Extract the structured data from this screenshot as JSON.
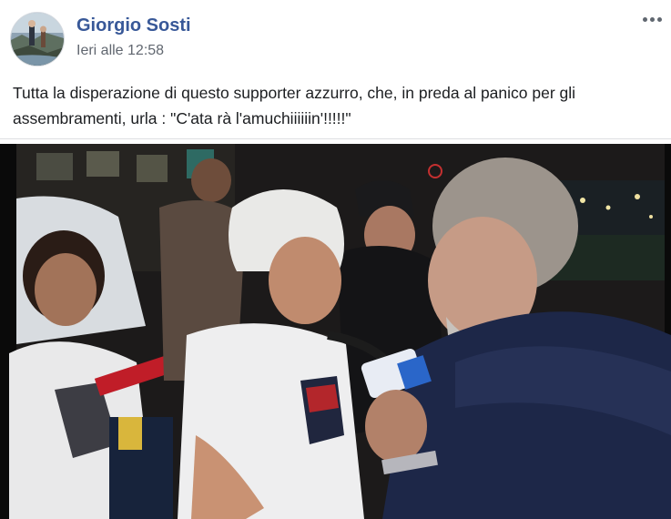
{
  "post": {
    "author": "Giorgio Sosti",
    "timestamp": "Ieri alle 12:58",
    "text": "Tutta la disperazione di questo supporter azzurro, che, in preda al panico per gli assembramenti, urla : \"C'ata rà l'amuchiiiiiin'!!!!!\""
  },
  "icons": {
    "more": "more-horizontal-icon",
    "avatar": "profile-photo"
  },
  "colors": {
    "author_link": "#385898",
    "timestamp": "#616770",
    "text": "#1c1e21",
    "divider": "#dddfe2"
  }
}
